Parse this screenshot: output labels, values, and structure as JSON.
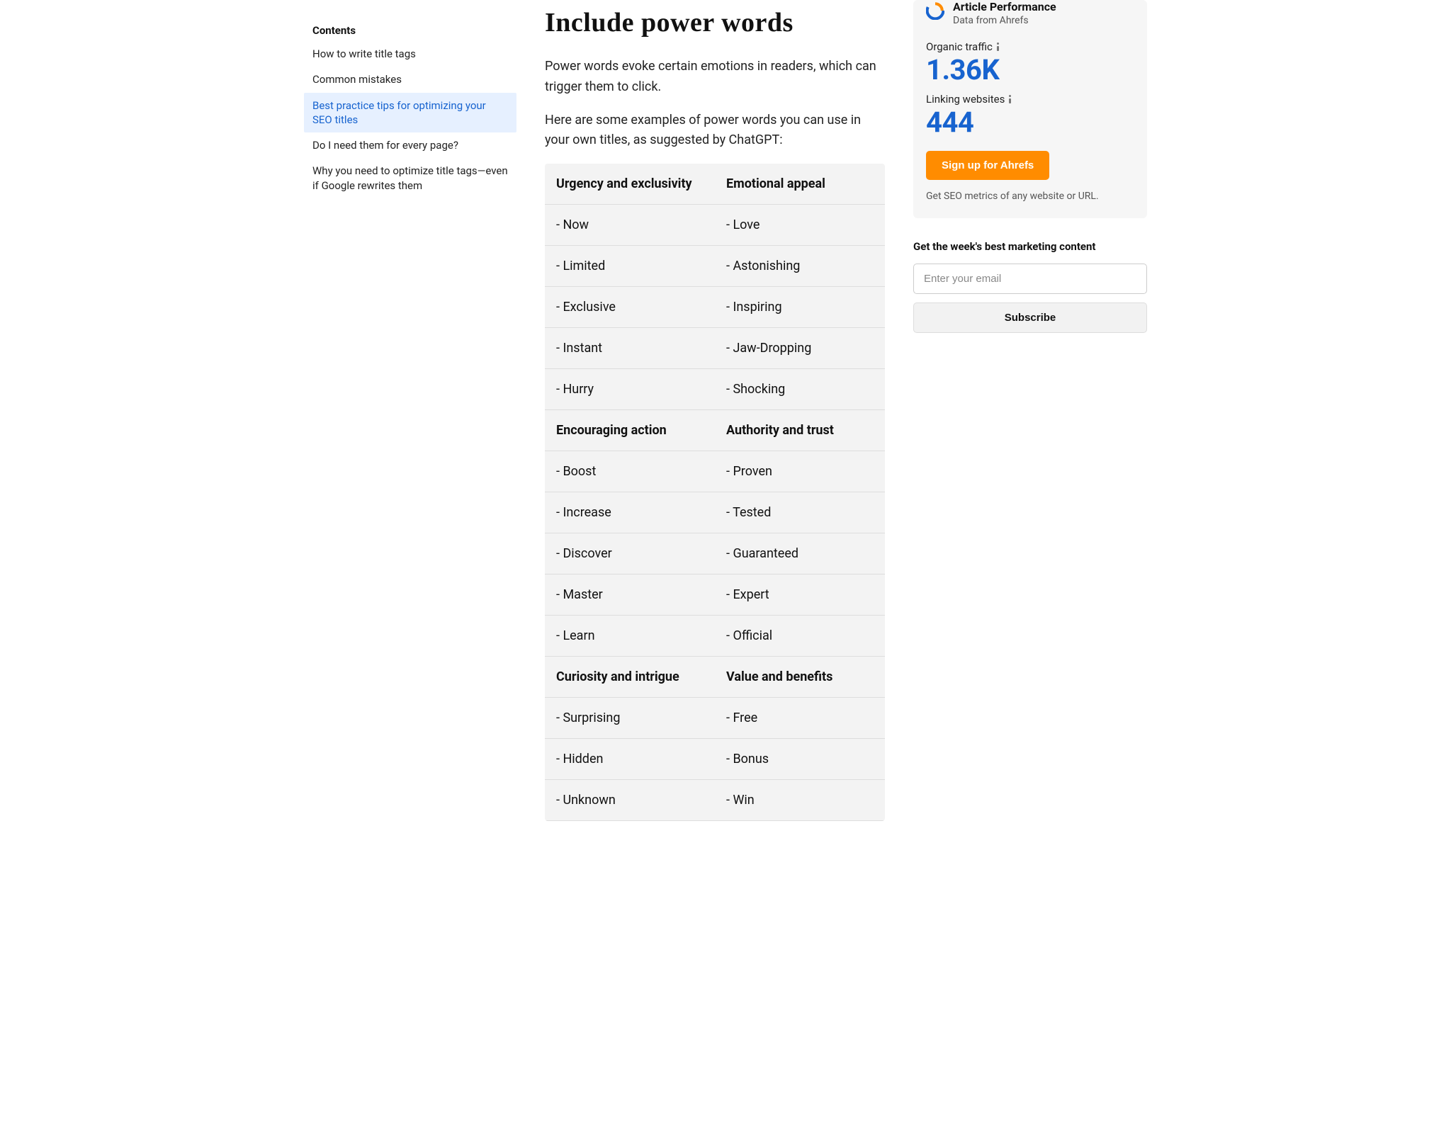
{
  "toc": {
    "title": "Contents",
    "items": [
      {
        "label": "How to write title tags",
        "active": false
      },
      {
        "label": "Common mistakes",
        "active": false
      },
      {
        "label": "Best practice tips for optimizing your SEO titles",
        "active": true
      },
      {
        "label": "Do I need them for every page?",
        "active": false
      },
      {
        "label": "Why you need to optimize title tags—even if Google rewrites them",
        "active": false
      }
    ]
  },
  "main": {
    "heading": "Include power words",
    "para1": "Power words evoke certain emotions in readers, which can trigger them to click.",
    "para2": "Here are some examples of power words you can use in your own titles, as suggested by ChatGPT:",
    "table": [
      {
        "leftHeader": "Urgency and exclusivity",
        "rightHeader": "Emotional appeal",
        "rows": [
          [
            "- Now",
            "- Love"
          ],
          [
            "- Limited",
            "- Astonishing"
          ],
          [
            "- Exclusive",
            "- Inspiring"
          ],
          [
            "- Instant",
            "- Jaw-Dropping"
          ],
          [
            "- Hurry",
            "- Shocking"
          ]
        ]
      },
      {
        "leftHeader": "Encouraging action",
        "rightHeader": "Authority and trust",
        "rows": [
          [
            "- Boost",
            "- Proven"
          ],
          [
            "- Increase",
            "- Tested"
          ],
          [
            "- Discover",
            "- Guaranteed"
          ],
          [
            "- Master",
            "- Expert"
          ],
          [
            "- Learn",
            "- Official"
          ]
        ]
      },
      {
        "leftHeader": "Curiosity and intrigue",
        "rightHeader": "Value and benefits",
        "rows": [
          [
            "- Surprising",
            "- Free"
          ],
          [
            "- Hidden",
            "- Bonus"
          ],
          [
            "- Unknown",
            "- Win"
          ]
        ]
      }
    ]
  },
  "rail": {
    "perf": {
      "title": "Article Performance",
      "subtitle": "Data from Ahrefs",
      "metric1_label": "Organic traffic",
      "metric1_value": "1.36K",
      "metric2_label": "Linking websites",
      "metric2_value": "444",
      "cta": "Sign up for Ahrefs",
      "note": "Get SEO metrics of any website or URL."
    },
    "newsletter": {
      "title": "Get the week's best marketing content",
      "placeholder": "Enter your email",
      "button": "Subscribe"
    }
  }
}
